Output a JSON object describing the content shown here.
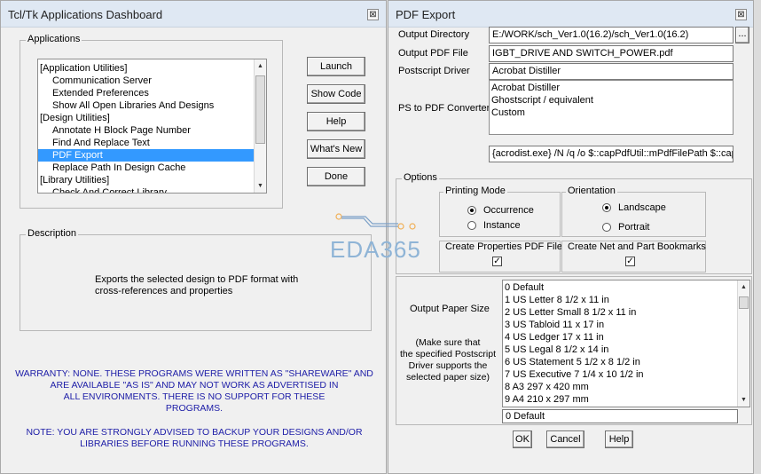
{
  "dashboard": {
    "title": "Tcl/Tk Applications Dashboard",
    "close_glyph": "⊠",
    "applications_label": "Applications",
    "apps": [
      {
        "label": "[Application Utilities]",
        "indent": false,
        "selected": false
      },
      {
        "label": "Communication Server",
        "indent": true,
        "selected": false
      },
      {
        "label": "Extended Preferences",
        "indent": true,
        "selected": false
      },
      {
        "label": "Show All Open Libraries And Designs",
        "indent": true,
        "selected": false
      },
      {
        "label": "[Design Utilities]",
        "indent": false,
        "selected": false
      },
      {
        "label": "Annotate H Block Page Number",
        "indent": true,
        "selected": false
      },
      {
        "label": "Find And Replace Text",
        "indent": true,
        "selected": false
      },
      {
        "label": "PDF Export",
        "indent": true,
        "selected": true
      },
      {
        "label": "Replace Path In Design Cache",
        "indent": true,
        "selected": false
      },
      {
        "label": "[Library Utilities]",
        "indent": false,
        "selected": false
      },
      {
        "label": "Check And Correct Library",
        "indent": true,
        "selected": false
      }
    ],
    "buttons": {
      "launch": "Launch",
      "show_code": "Show Code",
      "help": "Help",
      "whats_new": "What's New",
      "done": "Done"
    },
    "description_label": "Description",
    "description_line1": "Exports the selected design to PDF format with",
    "description_line2": "cross-references and properties",
    "warranty_lines": [
      "WARRANTY: NONE. THESE PROGRAMS WERE WRITTEN AS \"SHAREWARE\" AND",
      "ARE AVAILABLE \"AS IS\" AND MAY NOT WORK AS ADVERTISED IN",
      "ALL ENVIRONMENTS. THERE IS NO SUPPORT FOR THESE",
      "PROGRAMS."
    ],
    "note_lines": [
      "NOTE: YOU ARE STRONGLY ADVISED TO BACKUP YOUR DESIGNS AND/OR",
      "LIBRARIES BEFORE RUNNING THESE PROGRAMS."
    ]
  },
  "pdf_export": {
    "title": "PDF Export",
    "close_glyph": "⊠",
    "output_directory_label": "Output Directory",
    "output_directory_value": "E:/WORK/sch_Ver1.0(16.2)/sch_Ver1.0(16.2)",
    "browse_label": "...",
    "output_pdf_label": "Output PDF File",
    "output_pdf_value": "IGBT_DRIVE AND SWITCH_POWER.pdf",
    "postscript_driver_label": "Postscript Driver",
    "postscript_driver_value": "Acrobat Distiller",
    "ps_to_pdf_label": "PS to PDF Converter",
    "converters": [
      "Acrobat Distiller",
      "Ghostscript / equivalent",
      "Custom"
    ],
    "command_value": "{acrodist.exe} /N /q /o $::capPdfUtil::mPdfFilePath $::cap",
    "options_label": "Options",
    "printing_mode_label": "Printing Mode",
    "printing_mode_options": [
      {
        "label": "Occurrence",
        "selected": true
      },
      {
        "label": "Instance",
        "selected": false
      }
    ],
    "orientation_label": "Orientation",
    "orientation_options": [
      {
        "label": "Landscape",
        "selected": true
      },
      {
        "label": "Portrait",
        "selected": false
      }
    ],
    "create_properties_label": "Create Properties PDF File",
    "create_properties_checked": true,
    "create_bookmarks_label": "Create Net and Part Bookmarks",
    "create_bookmarks_checked": true,
    "check_glyph": "✓",
    "paper_size_label": "Output Paper Size",
    "paper_note_lines": [
      "(Make sure that",
      "the specified Postscript",
      "Driver supports the",
      "selected paper size)"
    ],
    "paper_sizes": [
      "0 Default",
      "1 US Letter 8 1/2 x 11 in",
      "2 US Letter Small 8 1/2 x 11 in",
      "3 US Tabloid 11 x 17 in",
      "4 US Ledger 17 x 11 in",
      "5 US Legal 8 1/2 x 14 in",
      "6 US Statement 5 1/2 x 8 1/2 in",
      "7 US Executive 7 1/4 x 10 1/2 in",
      "8 A3 297 x 420 mm",
      "9 A4 210 x 297 mm"
    ],
    "paper_size_selected": "0 Default",
    "ok_label": "OK",
    "cancel_label": "Cancel",
    "help_label": "Help"
  },
  "watermark": {
    "text": "EDA365",
    "color": "#8fb4d6"
  }
}
